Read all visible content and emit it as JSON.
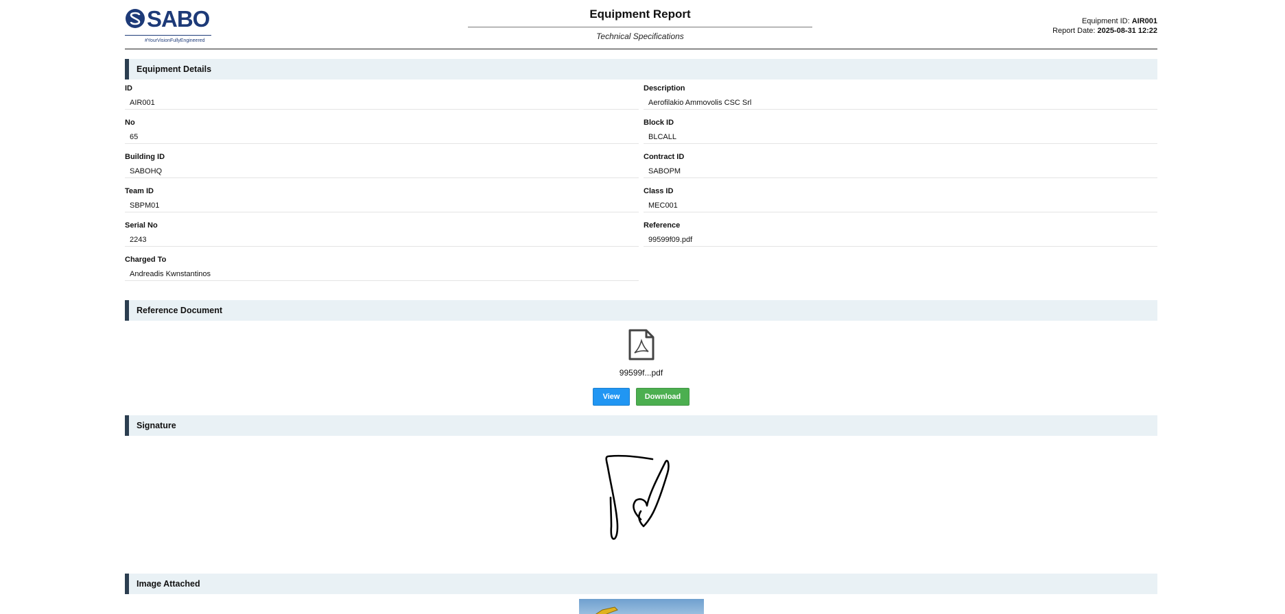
{
  "header": {
    "logo_text": "SABO",
    "logo_tagline": "#YourVisionFullyEngineered",
    "title": "Equipment Report",
    "subtitle": "Technical Specifications",
    "equipment_id_label": "Equipment ID:",
    "equipment_id": "AIR001",
    "report_date_label": "Report Date:",
    "report_date": "2025-08-31 12:22"
  },
  "sections": {
    "details": "Equipment Details",
    "reference": "Reference Document",
    "signature": "Signature",
    "image": "Image Attached"
  },
  "fields": [
    {
      "label": "ID",
      "value": "AIR001"
    },
    {
      "label": "Description",
      "value": "Aerofilakio Ammovolis CSC Srl"
    },
    {
      "label": "No",
      "value": "65"
    },
    {
      "label": "Block ID",
      "value": "BLCALL"
    },
    {
      "label": "Building ID",
      "value": "SABOHQ"
    },
    {
      "label": "Contract ID",
      "value": "SABOPM"
    },
    {
      "label": "Team ID",
      "value": "SBPM01"
    },
    {
      "label": "Class ID",
      "value": "MEC001"
    },
    {
      "label": "Serial No",
      "value": "2243"
    },
    {
      "label": "Reference",
      "value": "99599f09.pdf"
    },
    {
      "label": "Charged To",
      "value": "Andreadis Kwnstantinos"
    }
  ],
  "document": {
    "file_name": "99599f...pdf",
    "icon": "pdf-file-icon",
    "view_label": "View",
    "download_label": "Download"
  },
  "colors": {
    "brand": "#1d3a78",
    "section_bg": "#e9f1f5",
    "section_accent": "#2c3e50",
    "view_button": "#2196f3",
    "download_button": "#4caf50"
  }
}
